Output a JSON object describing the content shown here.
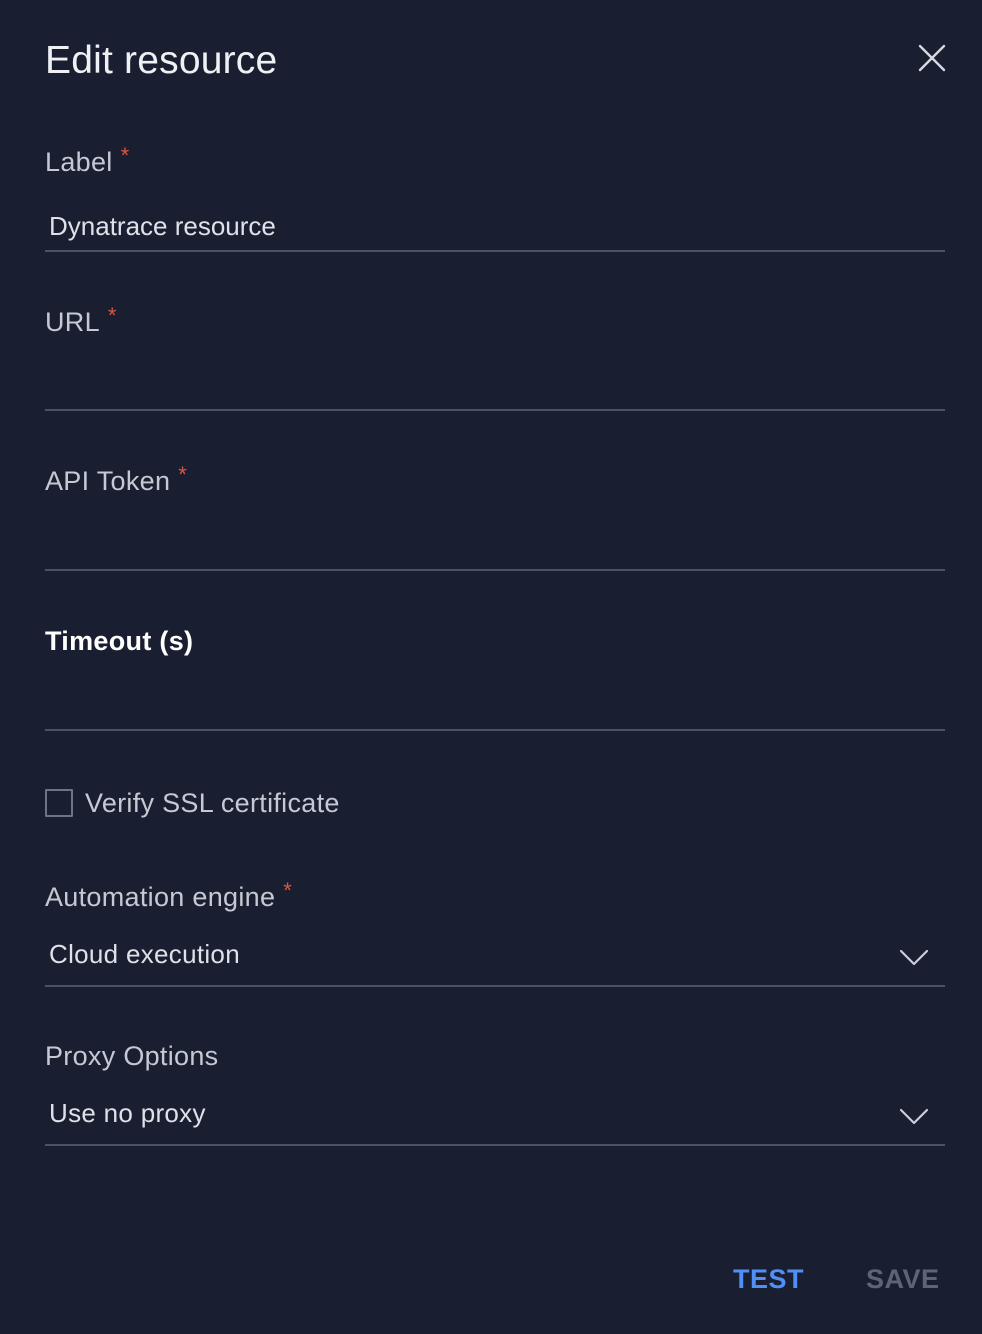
{
  "dialog": {
    "title": "Edit resource"
  },
  "fields": {
    "label": {
      "label": "Label",
      "required_mark": "*",
      "value": "Dynatrace resource"
    },
    "url": {
      "label": "URL",
      "required_mark": "*",
      "value": ""
    },
    "api_token": {
      "label": "API Token",
      "required_mark": "*",
      "value": ""
    },
    "timeout": {
      "label": "Timeout (s)",
      "value": ""
    },
    "verify_ssl": {
      "label": "Verify SSL certificate",
      "checked": false
    },
    "automation_engine": {
      "label": "Automation engine",
      "required_mark": "*",
      "value": "Cloud execution"
    },
    "proxy_options": {
      "label": "Proxy Options",
      "value": "Use no proxy"
    }
  },
  "footer": {
    "test_label": "TEST",
    "save_label": "SAVE"
  },
  "icons": {
    "close": "close-icon",
    "dropdown": "chevron-down-icon"
  },
  "colors": {
    "background": "#191f30",
    "required": "#e0553f",
    "accent": "#4f8ff7",
    "disabled": "#5b6478",
    "underline": "#48526a"
  }
}
